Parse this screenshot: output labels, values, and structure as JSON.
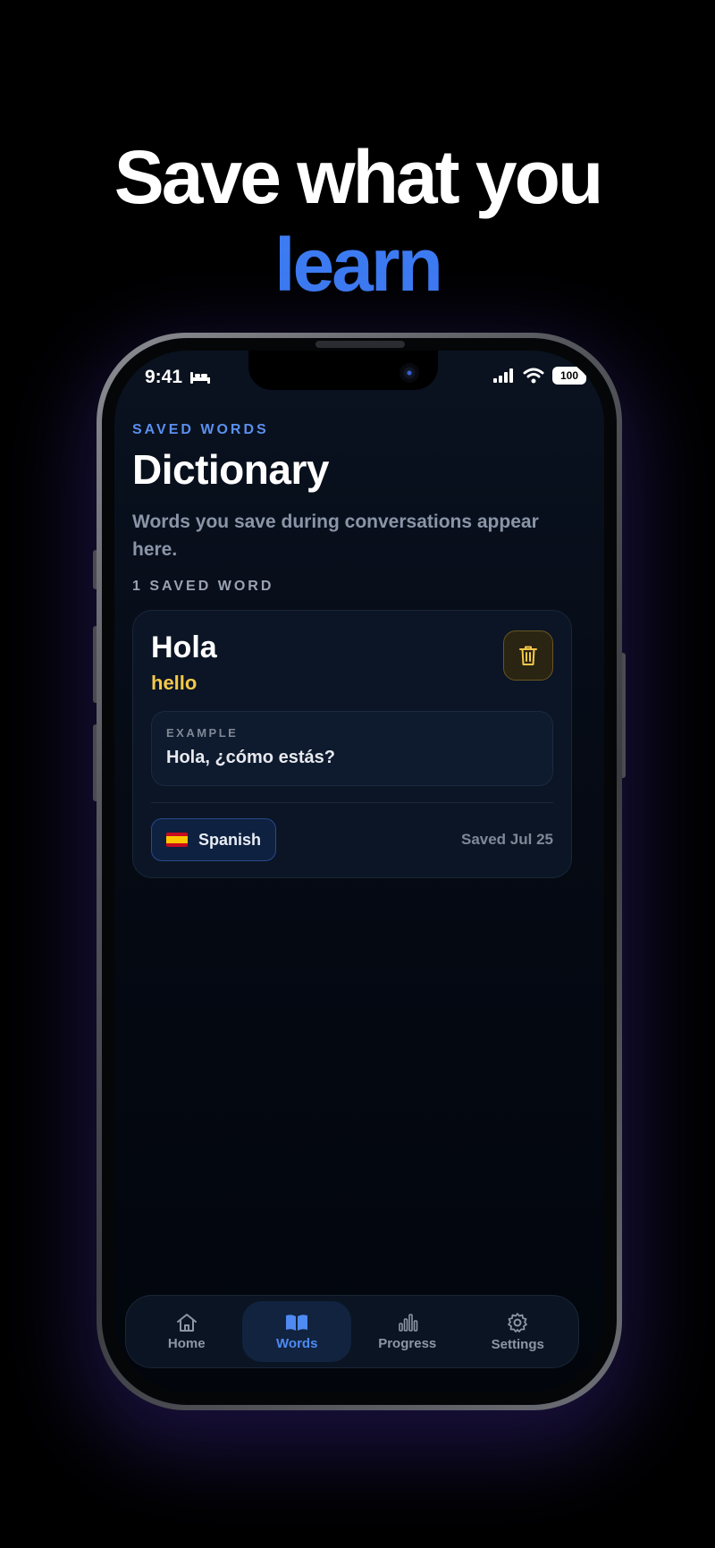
{
  "headline": {
    "line1": "Save what you",
    "line2": "learn"
  },
  "status_bar": {
    "time": "9:41",
    "battery": "100"
  },
  "page": {
    "eyebrow": "SAVED WORDS",
    "title": "Dictionary",
    "subtitle": "Words you save during conversations appear here.",
    "count_label": "1 SAVED WORD"
  },
  "words": [
    {
      "word": "Hola",
      "translation": "hello",
      "example_label": "EXAMPLE",
      "example": "Hola, ¿cómo estás?",
      "language": "Spanish",
      "saved": "Saved Jul 25"
    }
  ],
  "tabs": [
    {
      "label": "Home",
      "icon": "home-icon",
      "active": false
    },
    {
      "label": "Words",
      "icon": "book-icon",
      "active": true
    },
    {
      "label": "Progress",
      "icon": "bar-chart-icon",
      "active": false
    },
    {
      "label": "Settings",
      "icon": "gear-icon",
      "active": false
    }
  ],
  "colors": {
    "accent": "#3d7bf2",
    "translation": "#f4c84a",
    "background": "#000000"
  }
}
